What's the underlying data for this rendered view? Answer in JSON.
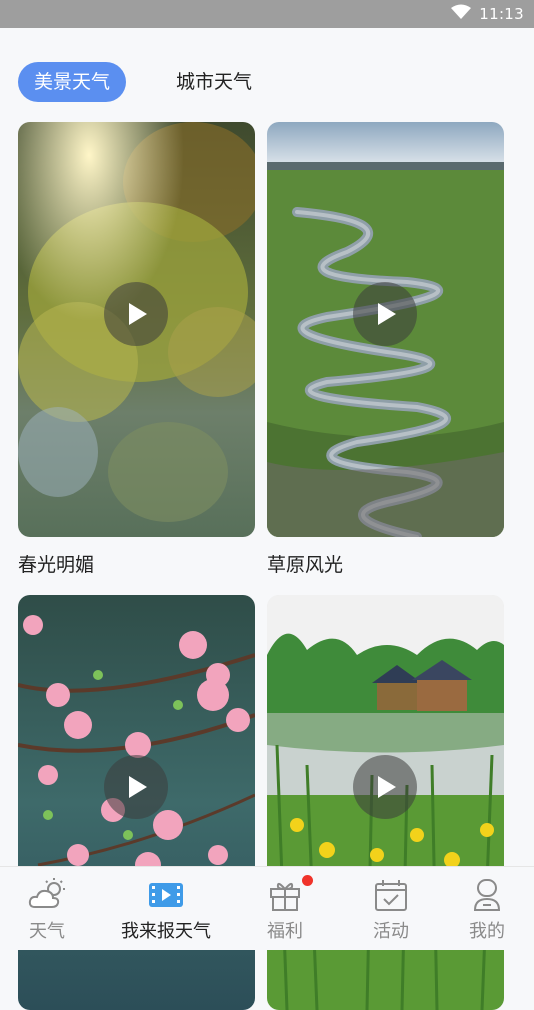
{
  "status_bar": {
    "time": "11:13"
  },
  "tabs": [
    {
      "label": "美景天气",
      "active": true
    },
    {
      "label": "城市天气",
      "active": false
    }
  ],
  "videos": [
    {
      "caption": "春光明媚",
      "icon": "play-icon"
    },
    {
      "caption": "草原风光",
      "icon": "play-icon"
    },
    {
      "caption": "",
      "icon": "play-icon"
    },
    {
      "caption": "",
      "icon": "play-icon"
    }
  ],
  "bottom_nav": [
    {
      "label": "天气",
      "icon": "weather-icon",
      "active": false
    },
    {
      "label": "我来报天气",
      "icon": "video-report-icon",
      "active": true
    },
    {
      "label": "福利",
      "icon": "gift-icon",
      "active": false,
      "badge": true
    },
    {
      "label": "活动",
      "icon": "calendar-check-icon",
      "active": false
    },
    {
      "label": "我的",
      "icon": "profile-icon",
      "active": false
    }
  ],
  "colors": {
    "accent": "#5b8ff0",
    "badge": "#f0332a",
    "status_bar": "#9e9e9e"
  }
}
